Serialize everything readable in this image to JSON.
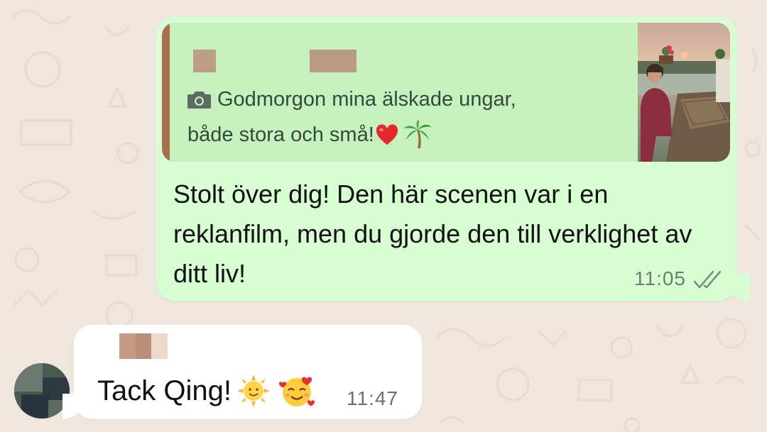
{
  "chat": {
    "outgoing_message": {
      "quoted": {
        "line1": "Godmorgon mina älskade ungar,",
        "line2": "både stora och små!",
        "icon": "camera-icon",
        "thumbnail": "photo-thumbnail",
        "emojis": [
          "red-heart",
          "palm-tree"
        ]
      },
      "text": "Stolt över dig! Den här scenen var i en reklanfilm, men du gjorde den till verklighet av ditt liv!",
      "time": "11:05",
      "status_icon": "double-check-icon"
    },
    "incoming_message": {
      "text": "Tack Qing!",
      "emojis": [
        "sun-with-face",
        "smiling-face-with-hearts"
      ],
      "time": "11:47"
    }
  },
  "colors": {
    "background": "#efe7dd",
    "outgoing_bubble": "#d9fdd3",
    "quote_background": "#c6f0bd",
    "quote_bar": "#a86f4e",
    "incoming_bubble": "#ffffff"
  }
}
